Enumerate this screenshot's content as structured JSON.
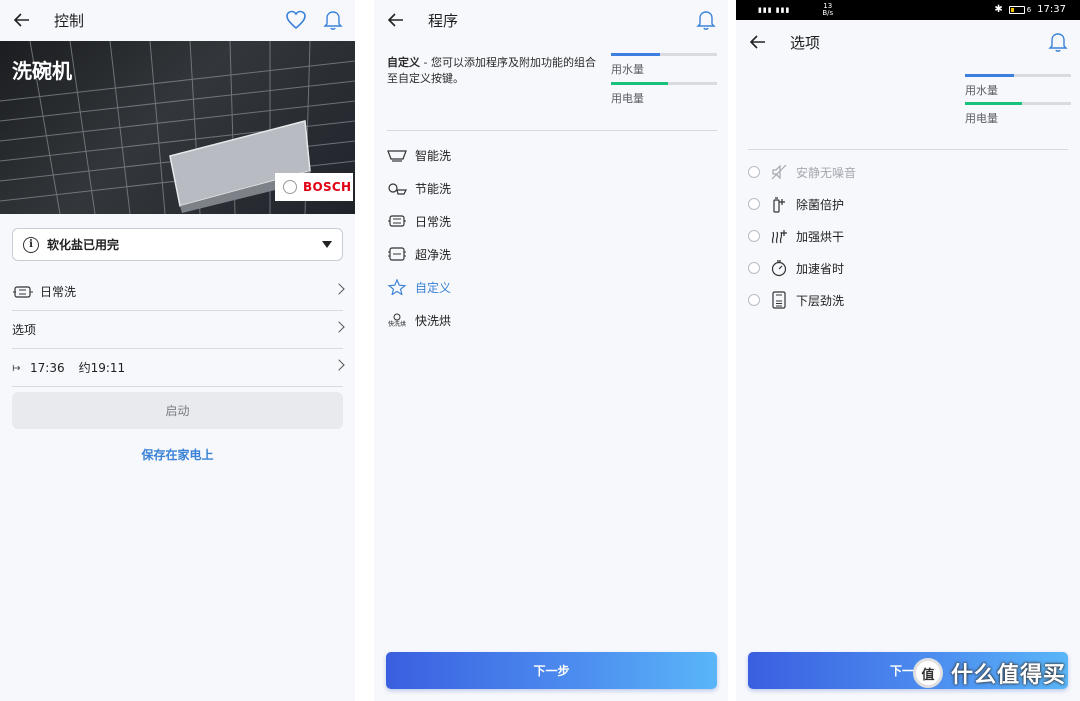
{
  "control": {
    "title": "控制",
    "hero_title": "洗碗机",
    "brand": "BOSCH",
    "notice": "软化盐已用完",
    "program_row": "日常洗",
    "options_row": "选项",
    "time_start": "17:36",
    "time_end": "约19:11",
    "start_button": "启动",
    "save_link": "保存在家电上"
  },
  "program": {
    "title": "程序",
    "intro_bold": "自定义",
    "intro_text": " - 您可以添加程序及附加功能的组合至自定义按键。",
    "water_label": "用水量",
    "power_label": "用电量",
    "water_level": 0.46,
    "power_level": 0.54,
    "items": [
      {
        "label": "智能洗",
        "icon": "smart-wash-icon"
      },
      {
        "label": "节能洗",
        "icon": "eco-wash-icon"
      },
      {
        "label": "日常洗",
        "icon": "daily-wash-icon"
      },
      {
        "label": "超净洗",
        "icon": "intensive-wash-icon"
      },
      {
        "label": "自定义",
        "icon": "star-icon"
      },
      {
        "label": "快洗烘",
        "icon": "quick-wash-icon",
        "icon_caption": "快洗烘"
      }
    ],
    "next_button": "下一步"
  },
  "options": {
    "status_time": "17:37",
    "status_speed_value": "13",
    "status_speed_unit": "B/s",
    "status_battery": "6",
    "title": "选项",
    "water_label": "用水量",
    "power_label": "用电量",
    "water_level": 0.46,
    "power_level": 0.54,
    "items": [
      {
        "label": "安静无噪音",
        "icon": "mute-icon",
        "enabled": false
      },
      {
        "label": "除菌倍护",
        "icon": "hygiene-icon",
        "enabled": true
      },
      {
        "label": "加强烘干",
        "icon": "extra-dry-icon",
        "enabled": true
      },
      {
        "label": "加速省时",
        "icon": "speed-icon",
        "enabled": true
      },
      {
        "label": "下层劲洗",
        "icon": "lower-basket-icon",
        "enabled": true
      }
    ],
    "next_button": "下一步",
    "watermark_badge": "值",
    "watermark": "什么值得买"
  },
  "colors": {
    "accent_blue": "#3a82d6",
    "water_bar": "#3d7fe0",
    "power_bar": "#19c27a",
    "brand_red": "#e20015"
  }
}
